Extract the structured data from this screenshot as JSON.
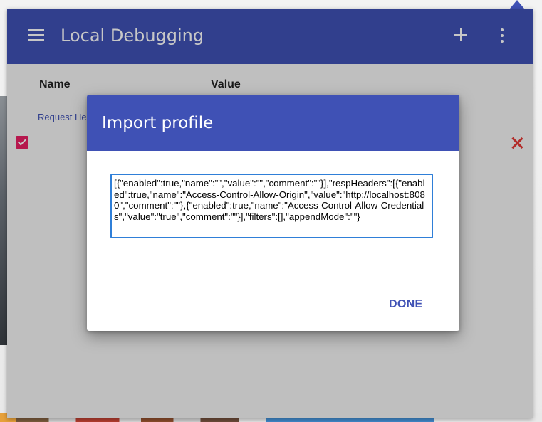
{
  "app": {
    "toolbar_title": "Local Debugging",
    "accent_color": "#3f51b5",
    "icons": [
      "menu-icon",
      "add-icon",
      "more-vert-icon"
    ]
  },
  "table": {
    "name_header": "Name",
    "value_header": "Value",
    "section_label": "Request Headers",
    "row": {
      "checkbox_checked": true,
      "checkbox_color": "#e91e63",
      "delete_icon": "close-icon",
      "delete_color": "#e53935"
    }
  },
  "dialog": {
    "title": "Import profile",
    "textarea_value": "[{\"enabled\":true,\"name\":\"\",\"value\":\"\",\"comment\":\"\"}],\"respHeaders\":[{\"enabled\":true,\"name\":\"Access-Control-Allow-Origin\",\"value\":\"http://localhost:8080\",\"comment\":\"\"},{\"enabled\":true,\"name\":\"Access-Control-Allow-Credentials\",\"value\":\"true\",\"comment\":\"\"}],\"filters\":[],\"appendMode\":\"\"}",
    "done_label": "DONE"
  }
}
